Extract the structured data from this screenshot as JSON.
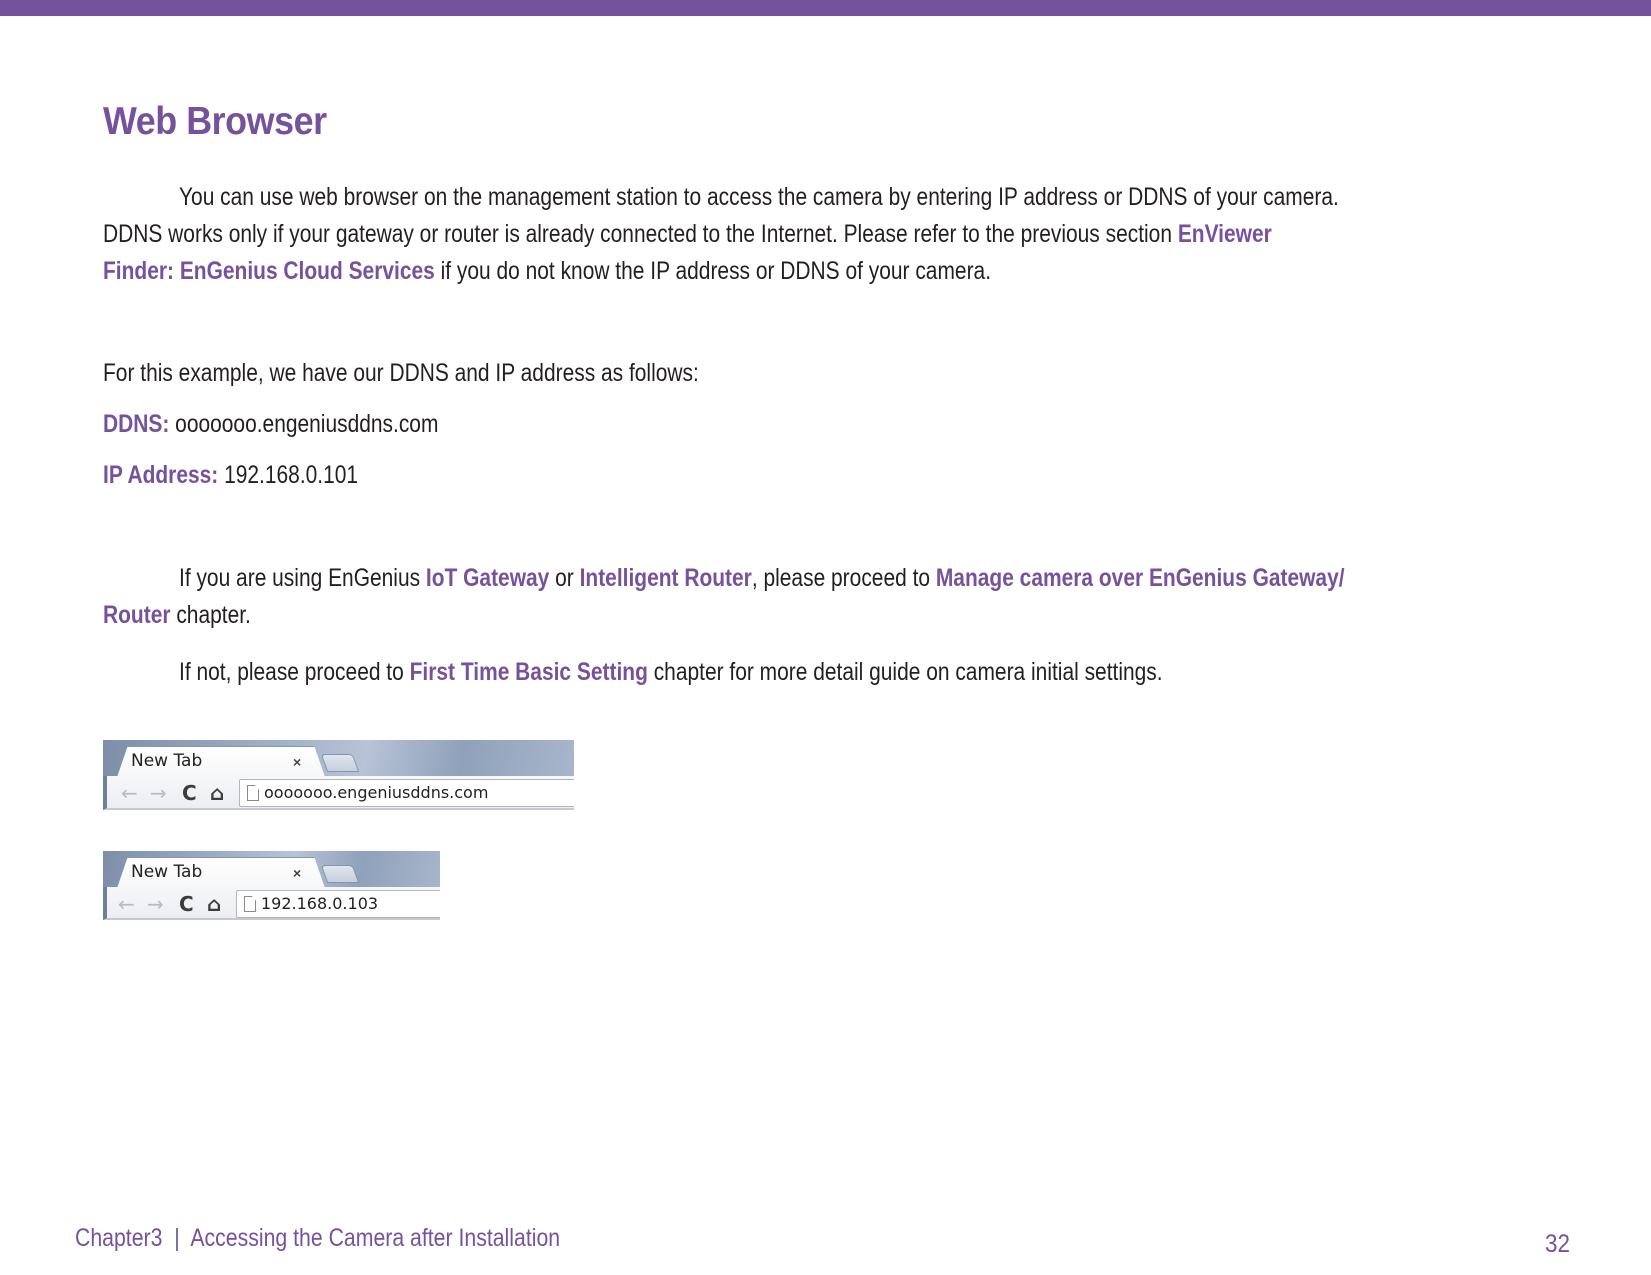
{
  "colors": {
    "accent": "#76529c",
    "text": "#231f20"
  },
  "section": {
    "title": "Web Browser"
  },
  "intro": {
    "line1": "You can use web browser on the management station to access the camera by entering IP address or DDNS of your camera.",
    "line2_text": "DDNS works only if your gateway or router is already connected to the Internet. Please refer to the previous section ",
    "line2_link": "EnViewer",
    "line3_link": "Finder: EnGenius Cloud Services",
    "line3_text": " if you do not know the IP address or DDNS of your camera."
  },
  "example": {
    "lead": "For this example, we have our DDNS and IP address as follows:",
    "ddns_label": "DDNS:",
    "ddns_value": " ooooooo.engeniusddns.com",
    "ip_label": "IP Address:",
    "ip_value": " 192.168.0.101"
  },
  "proceed": {
    "p1_a": "If you are using EnGenius ",
    "p1_link1": "IoT Gateway",
    "p1_b": " or ",
    "p1_link2": "Intelligent Router",
    "p1_c": ", please proceed to ",
    "p1_link3": "Manage camera over EnGenius Gateway/",
    "p1_link3_cont": "Router",
    "p1_d": " chapter.",
    "p2_a": "If not, please proceed to ",
    "p2_link": "First Time Basic Setting",
    "p2_b": " chapter for more detail guide on camera initial settings."
  },
  "browser_examples": [
    {
      "tab_label": "New Tab",
      "close_glyph": "×",
      "back_icon": "←",
      "forward_icon": "→",
      "reload_icon": "C",
      "home_icon": "⌂",
      "url": "ooooooo.engeniusddns.com"
    },
    {
      "tab_label": "New Tab",
      "close_glyph": "×",
      "back_icon": "←",
      "forward_icon": "→",
      "reload_icon": "C",
      "home_icon": "⌂",
      "url": "192.168.0.103"
    }
  ],
  "footer": {
    "chapter": "Chapter3  |  Accessing the Camera after Installation",
    "page_number": "32"
  }
}
